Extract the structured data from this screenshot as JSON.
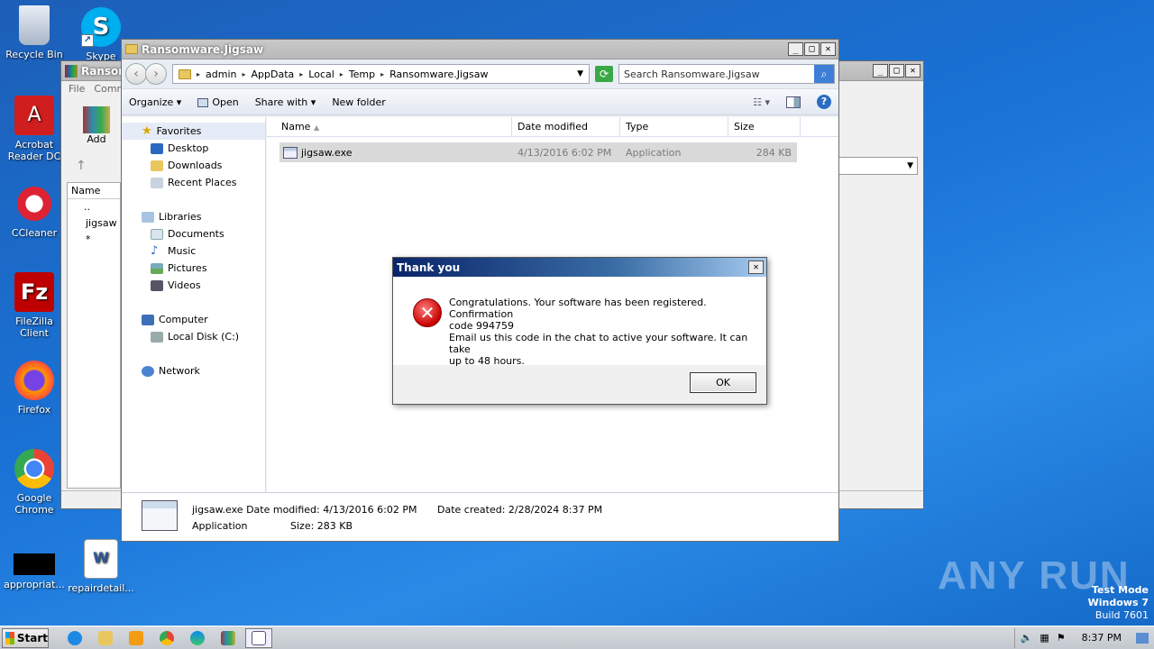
{
  "desktop": {
    "icons": [
      {
        "label": "Recycle Bin"
      },
      {
        "label": "Skype"
      },
      {
        "label": "Acrobat Reader DC"
      },
      {
        "label": "CCleaner"
      },
      {
        "label": "FileZilla Client"
      },
      {
        "label": "Firefox"
      },
      {
        "label": "Google Chrome"
      },
      {
        "label": "appropriat..."
      },
      {
        "label": "repairdetail..."
      }
    ],
    "watermark": "ANY RUN",
    "test_mode": {
      "line1": "Test Mode",
      "line2": "Windows 7",
      "line3": "Build 7601"
    }
  },
  "back_window": {
    "title": "Ransom",
    "menu": [
      "File",
      "Comm"
    ],
    "add_label": "Add",
    "col_name": "Name",
    "rows": [
      "..",
      "jigsaw *"
    ]
  },
  "explorer": {
    "title": "Ransomware.Jigsaw",
    "breadcrumbs": [
      "admin",
      "AppData",
      "Local",
      "Temp",
      "Ransomware.Jigsaw"
    ],
    "search_placeholder": "Search Ransomware.Jigsaw",
    "toolbar": {
      "organize": "Organize",
      "open": "Open",
      "share_with": "Share with",
      "new_folder": "New folder"
    },
    "nav": {
      "favorites": "Favorites",
      "desktop": "Desktop",
      "downloads": "Downloads",
      "recent": "Recent Places",
      "libraries": "Libraries",
      "documents": "Documents",
      "music": "Music",
      "pictures": "Pictures",
      "videos": "Videos",
      "computer": "Computer",
      "local_disk": "Local Disk (C:)",
      "network": "Network"
    },
    "columns": {
      "name": "Name",
      "date_modified": "Date modified",
      "type": "Type",
      "size": "Size"
    },
    "file": {
      "name": "jigsaw.exe",
      "date": "4/13/2016 6:02 PM",
      "type": "Application",
      "size": "284 KB"
    },
    "details": {
      "name": "jigsaw.exe",
      "date_modified_label": "Date modified:",
      "date_modified": "4/13/2016 6:02 PM",
      "date_created_label": "Date created:",
      "date_created": "2/28/2024 8:37 PM",
      "type": "Application",
      "size_label": "Size:",
      "size": "283 KB"
    }
  },
  "dialog": {
    "title": "Thank you",
    "line1": "Congratulations. Your software has been registered. Confirmation",
    "line2": "code 994759",
    "line3": "Email us this code in the chat to active your software. It can take",
    "line4": "up to 48 hours.",
    "ok": "OK"
  },
  "taskbar": {
    "start": "Start",
    "clock": "8:37 PM"
  }
}
